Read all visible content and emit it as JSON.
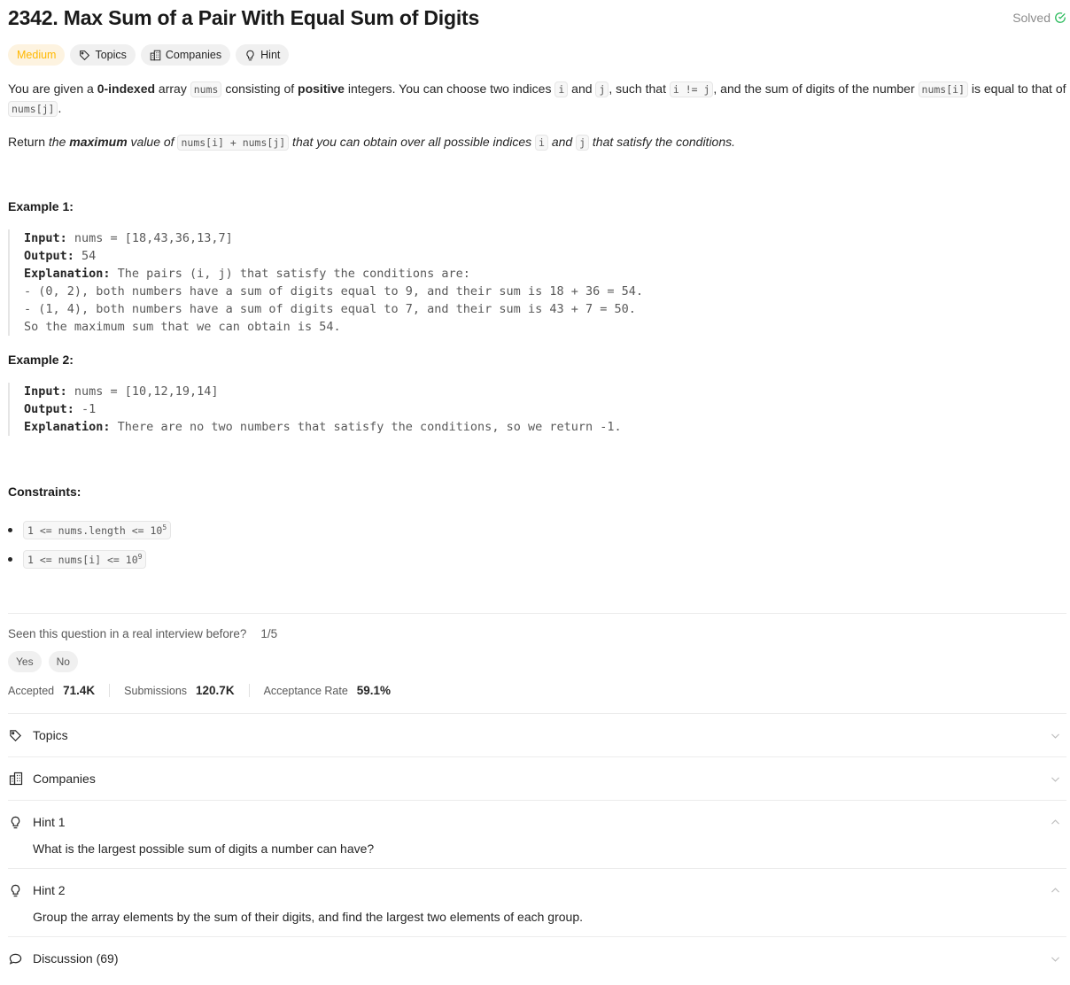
{
  "title": "2342. Max Sum of a Pair With Equal Sum of Digits",
  "solved_label": "Solved",
  "tags": {
    "difficulty": "Medium",
    "topics": "Topics",
    "companies": "Companies",
    "hint": "Hint"
  },
  "colors": {
    "medium": "#ffb800",
    "solved": "#2cbb5d"
  },
  "description": {
    "p1_a": "You are given a ",
    "p1_b": "0-indexed",
    "p1_c": " array ",
    "p1_d": "nums",
    "p1_e": " consisting of ",
    "p1_f": "positive",
    "p1_g": " integers. You can choose two indices ",
    "p1_h": "i",
    "p1_i": " and ",
    "p1_j": "j",
    "p1_k": ", such that ",
    "p1_l": "i != j",
    "p1_m": ", and the sum of digits of the number ",
    "p1_n": "nums[i]",
    "p1_o": " is equal to that of ",
    "p1_p": "nums[j]",
    "p1_q": ".",
    "p2_a": "Return ",
    "p2_b": "the ",
    "p2_c": "maximum",
    "p2_d": " value of ",
    "p2_e": "nums[i] + nums[j]",
    "p2_f": " that you can obtain over all possible indices ",
    "p2_g": "i",
    "p2_h": " and ",
    "p2_i": "j",
    "p2_j": " that satisfy the conditions."
  },
  "examples": [
    {
      "title": "Example 1:",
      "input_label": "Input:",
      "input": " nums = [18,43,36,13,7]",
      "output_label": "Output:",
      "output": " 54",
      "explanation_label": "Explanation:",
      "explanation": " The pairs (i, j) that satisfy the conditions are:",
      "lines": [
        "- (0, 2), both numbers have a sum of digits equal to 9, and their sum is 18 + 36 = 54.",
        "- (1, 4), both numbers have a sum of digits equal to 7, and their sum is 43 + 7 = 50.",
        "So the maximum sum that we can obtain is 54."
      ]
    },
    {
      "title": "Example 2:",
      "input_label": "Input:",
      "input": " nums = [10,12,19,14]",
      "output_label": "Output:",
      "output": " -1",
      "explanation_label": "Explanation:",
      "explanation": " There are no two numbers that satisfy the conditions, so we return -1."
    }
  ],
  "constraints": {
    "title": "Constraints:",
    "c1_text": "1 <= nums.length <= 10",
    "c1_exp": "5",
    "c2_text": "1 <= nums[i] <= 10",
    "c2_exp": "9"
  },
  "interview": {
    "question": "Seen this question in a real interview before?",
    "ratio": "1/5",
    "yes": "Yes",
    "no": "No"
  },
  "stats": {
    "accepted_label": "Accepted",
    "accepted": "71.4K",
    "submissions_label": "Submissions",
    "submissions": "120.7K",
    "rate_label": "Acceptance Rate",
    "rate": "59.1%"
  },
  "sections": {
    "topics": "Topics",
    "companies": "Companies",
    "hint1": "Hint 1",
    "hint1_body": "What is the largest possible sum of digits a number can have?",
    "hint2": "Hint 2",
    "hint2_body": "Group the array elements by the sum of their digits, and find the largest two elements of each group.",
    "discussion": "Discussion (69)"
  }
}
